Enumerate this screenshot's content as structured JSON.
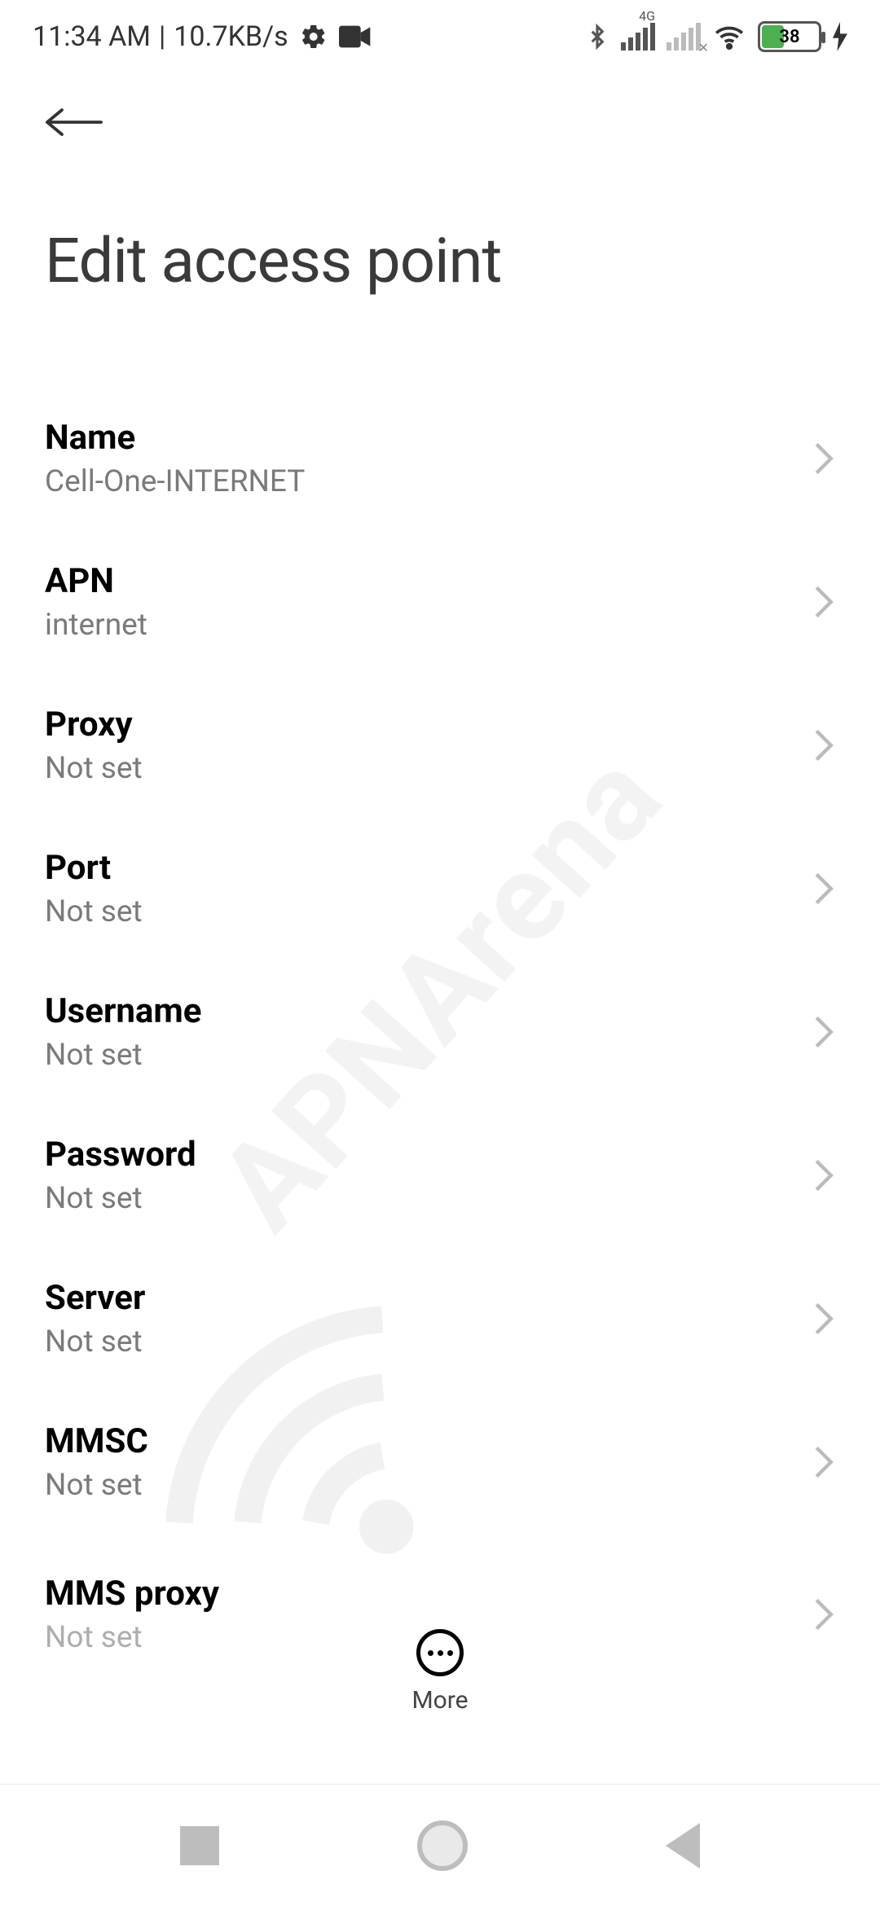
{
  "status": {
    "time": "11:34 AM",
    "separator": "|",
    "speed": "10.7KB/s",
    "battery_percent": "38",
    "network_badge": "4G"
  },
  "header": {
    "title": "Edit access point"
  },
  "rows": {
    "name": {
      "label": "Name",
      "value": "Cell-One-INTERNET"
    },
    "apn": {
      "label": "APN",
      "value": "internet"
    },
    "proxy": {
      "label": "Proxy",
      "value": "Not set"
    },
    "port": {
      "label": "Port",
      "value": "Not set"
    },
    "username": {
      "label": "Username",
      "value": "Not set"
    },
    "password": {
      "label": "Password",
      "value": "Not set"
    },
    "server": {
      "label": "Server",
      "value": "Not set"
    },
    "mmsc": {
      "label": "MMSC",
      "value": "Not set"
    },
    "mmsproxy": {
      "label": "MMS proxy",
      "value": "Not set"
    }
  },
  "more_label": "More",
  "watermark": "APNArena"
}
